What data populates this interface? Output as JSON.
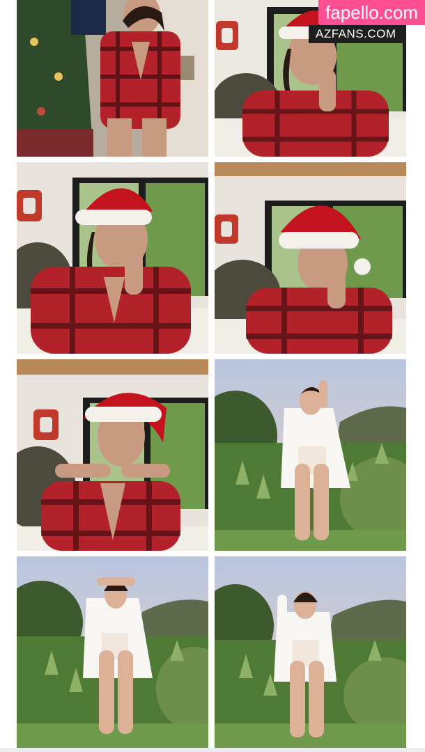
{
  "watermark": {
    "brand": "fapello.com",
    "site": "AZFANS.COM"
  },
  "gallery": {
    "photos": [
      {
        "scene": "christmas-tree-plaid-romper"
      },
      {
        "scene": "bed-santa-hat-hand-on-face"
      },
      {
        "scene": "bed-santa-hat-pose"
      },
      {
        "scene": "bed-santa-hat-smile"
      },
      {
        "scene": "bed-santa-hat-hands-near-chin"
      },
      {
        "scene": "garden-white-shirt-arms-up"
      },
      {
        "scene": "garden-white-shirt-hands-on-head"
      },
      {
        "scene": "garden-white-shirt-one-arm-up"
      }
    ]
  },
  "colors": {
    "brand_pink": "#ff4f93",
    "site_bg": "#1f1f1f",
    "plaid_red": "#b3212b",
    "hat_red": "#c4121f",
    "sky": "#c9d4e6",
    "grass": "#5f8a3c"
  }
}
